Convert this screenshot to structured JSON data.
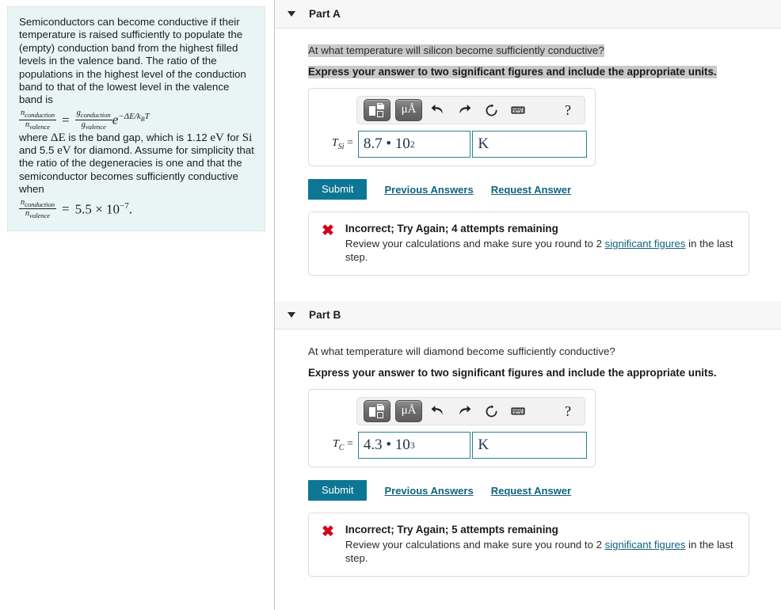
{
  "problem": {
    "paragraph_1": "Semiconductors can become conductive if their temperature is raised sufficiently to populate the (empty) conduction band from the highest filled levels in the valence band. The ratio of the populations in the highest level of the conduction band to that of the lowest level in the valence band is",
    "equation_1": {
      "lhs_num": "n_conduction",
      "lhs_num_display": "n",
      "lhs_num_sub": "conduction",
      "lhs_den_display": "n",
      "lhs_den_sub": "valence",
      "equals": "=",
      "rhs_num_display": "g",
      "rhs_num_sub": "conduction",
      "rhs_den_display": "g",
      "rhs_den_sub": "valence",
      "exponential_base": "e",
      "exponent": "−ΔE/k",
      "exponent_sub": "B",
      "exponent_tail": "T"
    },
    "paragraph_2_a": "where ",
    "paragraph_2_deltaE": "ΔE",
    "paragraph_2_b": " is the band gap, which is 1.12 ",
    "paragraph_2_ev1": "eV",
    "paragraph_2_c": " for ",
    "paragraph_2_si": "Si",
    "paragraph_2_d": " and 5.5 ",
    "paragraph_2_ev2": "eV",
    "paragraph_2_e": " for diamond. Assume for simplicity that the ratio of the degeneracies is one and that the semiconductor becomes sufficiently conductive when",
    "equation_2": {
      "lhs_num_display": "n",
      "lhs_num_sub": "conduction",
      "lhs_den_display": "n",
      "lhs_den_sub": "valence",
      "equals": "=",
      "value": "5.5 × 10",
      "exponent": "−7",
      "period": "."
    }
  },
  "parts": [
    {
      "id": "part-a",
      "title": "Part A",
      "question": "At what temperature will silicon become sufficiently conductive?",
      "question_highlighted": true,
      "instruction": "Express your answer to two significant figures and include the appropriate units.",
      "instruction_highlighted": true,
      "toolbar": {
        "template_icon": "math-template-icon",
        "units_label": "μÅ",
        "undo_icon": "undo-icon",
        "redo_icon": "redo-icon",
        "reset_icon": "reset-icon",
        "keyboard_icon": "keyboard-icon",
        "help_label": "?"
      },
      "answer": {
        "label_var": "T",
        "label_sub": "Si",
        "label_equals": "=",
        "mantissa": "8.7 • 10",
        "exponent": "2",
        "unit_value": "K",
        "unit_placeholder": ""
      },
      "submit_label": "Submit",
      "previous_answers_label": "Previous Answers",
      "request_answer_label": "Request Answer",
      "feedback": {
        "icon": "error-x-icon",
        "icon_color": "#d0011b",
        "title": "Incorrect; Try Again; 4 attempts remaining",
        "detail_before": "Review your calculations and make sure you round to 2 ",
        "detail_link": "significant figures",
        "detail_after": " in the last step."
      }
    },
    {
      "id": "part-b",
      "title": "Part B",
      "question": "At what temperature will diamond become sufficiently conductive?",
      "question_highlighted": false,
      "instruction": "Express your answer to two significant figures and include the appropriate units.",
      "instruction_highlighted": false,
      "toolbar": {
        "template_icon": "math-template-icon",
        "units_label": "μÅ",
        "undo_icon": "undo-icon",
        "redo_icon": "redo-icon",
        "reset_icon": "reset-icon",
        "keyboard_icon": "keyboard-icon",
        "help_label": "?"
      },
      "answer": {
        "label_var": "T",
        "label_sub": "C",
        "label_equals": "=",
        "mantissa": "4.3 • 10",
        "exponent": "3",
        "unit_value": "K",
        "unit_placeholder": ""
      },
      "submit_label": "Submit",
      "previous_answers_label": "Previous Answers",
      "request_answer_label": "Request Answer",
      "feedback": {
        "icon": "error-x-icon",
        "icon_color": "#d0011b",
        "title": "Incorrect; Try Again; 5 attempts remaining",
        "detail_before": "Review your calculations and make sure you round to 2 ",
        "detail_link": "significant figures",
        "detail_after": " in the last step."
      }
    }
  ],
  "colors": {
    "problem_panel_bg": "#e9f5f4",
    "accent_teal": "#0d7694",
    "link": "#11637f",
    "error_red": "#d0011b",
    "selection_gray": "#c9c9c9",
    "input_border": "#2b7f93"
  }
}
